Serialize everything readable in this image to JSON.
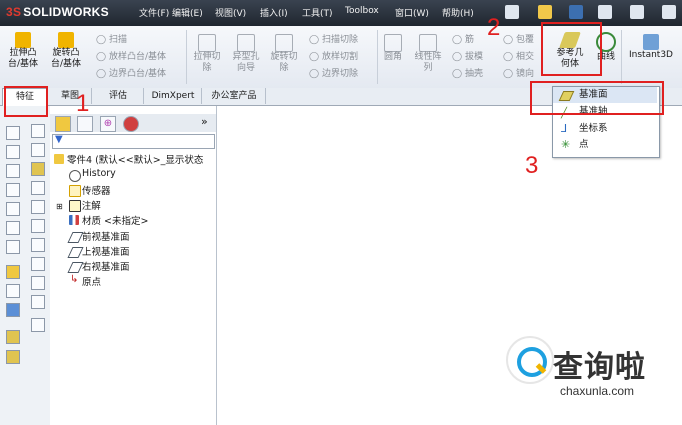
{
  "app": {
    "logo_prefix": "3S",
    "logo_text": "SOLIDWORKS"
  },
  "menubar": [
    "文件(F)",
    "编辑(E)",
    "视图(V)",
    "插入(I)",
    "工具(T)",
    "Toolbox",
    "窗口(W)",
    "帮助(H)"
  ],
  "ribbon": {
    "extrude_boss": "拉伸凸\n台/基体",
    "revolve_boss": "旋转凸\n台/基体",
    "sweep": "扫描",
    "loft": "放样凸台/基体",
    "boundary": "边界凸台/基体",
    "extrude_cut": "拉伸切\n除",
    "hole_wizard": "异型孔\n向导",
    "revolve_cut": "旋转切\n除",
    "sweep_cut": "扫描切除",
    "loft_cut": "放样切割",
    "boundary_cut": "边界切除",
    "fillet": "圆角",
    "linear_pattern": "线性阵\n列",
    "rib": "筋",
    "draft": "拔模",
    "shell": "抽壳",
    "wrap": "包覆",
    "intersect": "相交",
    "mirror": "镜向",
    "ref_geometry": "参考几\n何体",
    "curves": "曲线",
    "instant3d": "Instant3D"
  },
  "tabs": [
    "特征",
    "草图",
    "评估",
    "DimXpert",
    "办公室产品"
  ],
  "dropdown": [
    "基准面",
    "基准轴",
    "坐标系",
    "点"
  ],
  "tree": {
    "root": "零件4 (默认<<默认>_显示状态",
    "items": [
      "History",
      "传感器",
      "注解",
      "材质 <未指定>",
      "前视基准面",
      "上视基准面",
      "右视基准面",
      "原点"
    ]
  },
  "annotations": {
    "step1": "1",
    "step2": "2",
    "step3": "3"
  },
  "watermark": {
    "brand": "查询啦",
    "url": "chaxunla.com"
  },
  "colors": {
    "highlight": "#e02020",
    "accent": "#f0b400"
  }
}
